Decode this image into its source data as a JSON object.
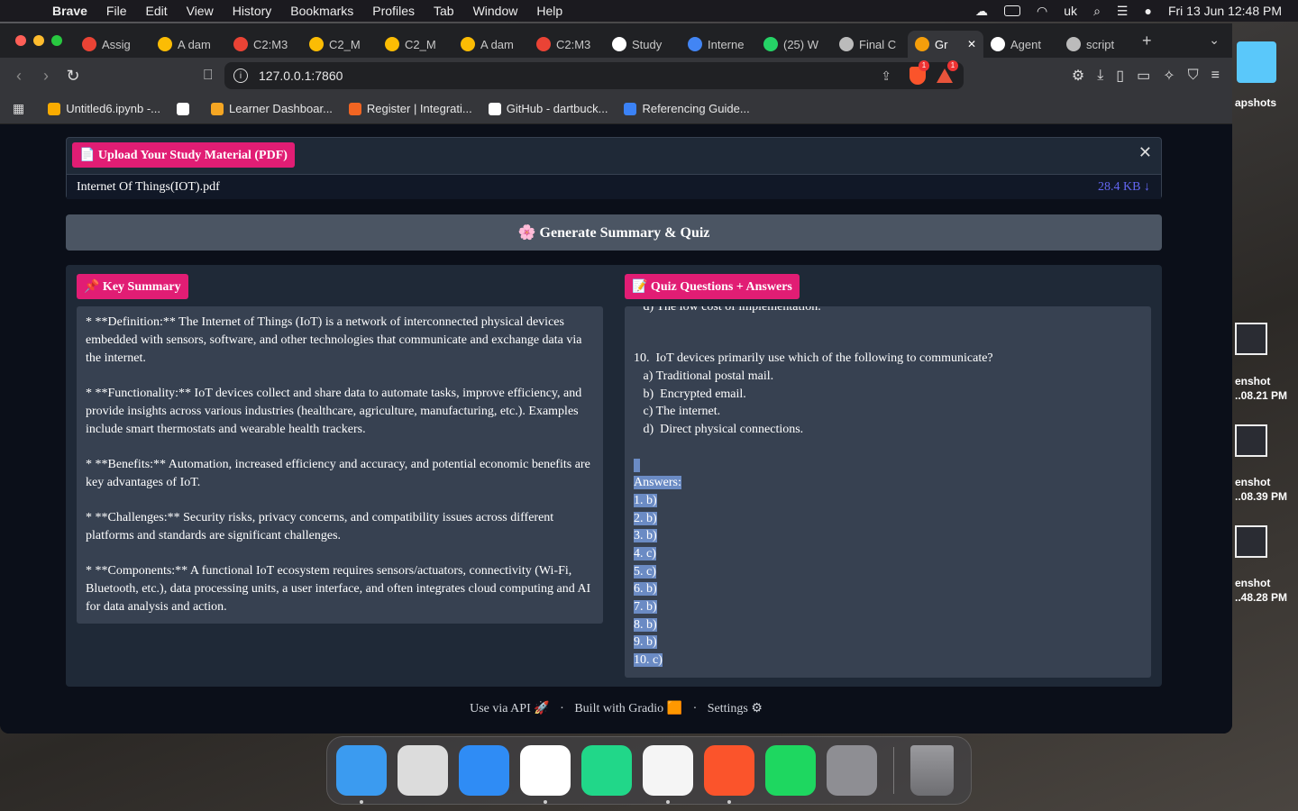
{
  "menubar": {
    "app": "Brave",
    "items": [
      "File",
      "Edit",
      "View",
      "History",
      "Bookmarks",
      "Profiles",
      "Tab",
      "Window",
      "Help"
    ],
    "input_source": "uk",
    "datetime": "Fri 13 Jun  12:48 PM"
  },
  "tabs": [
    {
      "label": "Assig",
      "color": "#ea4335"
    },
    {
      "label": "A dam",
      "color": "#fbbc04"
    },
    {
      "label": "C2:M3",
      "color": "#ea4335"
    },
    {
      "label": "C2_M",
      "color": "#fbbc04"
    },
    {
      "label": "C2_M",
      "color": "#fbbc04"
    },
    {
      "label": "A dam",
      "color": "#fbbc04"
    },
    {
      "label": "C2:M3",
      "color": "#ea4335"
    },
    {
      "label": "Study",
      "color": "#ffffff"
    },
    {
      "label": "Interne",
      "color": "#4285f4"
    },
    {
      "label": "(25) W",
      "color": "#25d366"
    },
    {
      "label": "Final C",
      "color": "#bbbbbb"
    },
    {
      "label": "Gr",
      "color": "#f59e0b",
      "active": true
    },
    {
      "label": "Agent",
      "color": "#ffffff"
    },
    {
      "label": "script",
      "color": "#bbbbbb"
    }
  ],
  "address_bar": {
    "url": "127.0.0.1:7860",
    "shields_badge": "1",
    "rewards_badge": "1"
  },
  "bookmarks": [
    {
      "label": "Untitled6.ipynb -...",
      "color": "#f9ab00"
    },
    {
      "label": "",
      "color": "#ffffff"
    },
    {
      "label": "Learner Dashboar...",
      "color": "#f5a623"
    },
    {
      "label": "Register | Integrati...",
      "color": "#f26522"
    },
    {
      "label": "GitHub - dartbuck...",
      "color": "#ffffff"
    },
    {
      "label": "Referencing Guide...",
      "color": "#3b82f6"
    }
  ],
  "upload": {
    "label": "📄 Upload Your Study Material (PDF)",
    "filename": "Internet Of Things(IOT).pdf",
    "filesize": "28.4 KB ↓"
  },
  "generate_button": "🌸 Generate Summary & Quiz",
  "summary": {
    "label": "📌 Key Summary",
    "paragraphs": [
      "* **Definition:** The Internet of Things (IoT) is a network of interconnected physical devices embedded with sensors, software, and other technologies that communicate and exchange data via the internet.",
      "* **Functionality:** IoT devices collect and share data to automate tasks, improve efficiency, and provide insights across various industries (healthcare, agriculture, manufacturing, etc.).  Examples include smart thermostats and wearable health trackers.",
      "* **Benefits:**  Automation, increased efficiency and accuracy, and potential economic benefits are key advantages of IoT.",
      "* **Challenges:** Security risks, privacy concerns, and compatibility issues across different platforms and standards are significant challenges.",
      "* **Components:**  A functional IoT ecosystem requires sensors/actuators, connectivity (Wi-Fi, Bluetooth, etc.), data processing units, a user interface, and often integrates cloud computing and AI for data analysis and action."
    ]
  },
  "quiz": {
    "label": "📝 Quiz Questions + Answers",
    "cutoff_line": "   d) The low cost of implementation.",
    "question": "10.  IoT devices primarily use which of the following to communicate?",
    "options": [
      "   a) Traditional postal mail.",
      "   b)  Encrypted email.",
      "   c) The internet.",
      "   d)  Direct physical connections."
    ],
    "answers_header": "Answers:",
    "answers": [
      "1. b)",
      "2. b)",
      "3. b)",
      "4. c)",
      "5. c)",
      "6. b)",
      "7. b)",
      "8. b)",
      "9. b)",
      "10. c)"
    ]
  },
  "footer": {
    "api": "Use via API 🚀",
    "built": "Built with Gradio 🟧",
    "settings": "Settings ⚙"
  },
  "desktop": {
    "folder_label": "apshots",
    "screenshots": [
      {
        "line1": "enshot",
        "line2": "..08.21 PM"
      },
      {
        "line1": "enshot",
        "line2": "..08.39 PM"
      },
      {
        "line1": "enshot",
        "line2": "..48.28 PM"
      }
    ]
  },
  "dock": [
    {
      "name": "Finder",
      "color": "#3b9bf0",
      "running": true
    },
    {
      "name": "Launchpad",
      "color": "#dcdcdc",
      "running": false
    },
    {
      "name": "Mail",
      "color": "#2f8cf5",
      "running": false
    },
    {
      "name": "VS Code",
      "color": "#ffffff",
      "running": true
    },
    {
      "name": "PyCharm",
      "color": "#21d789",
      "running": false
    },
    {
      "name": "Safari",
      "color": "#f5f5f5",
      "running": true
    },
    {
      "name": "Brave",
      "color": "#fb542b",
      "running": true
    },
    {
      "name": "Spotify",
      "color": "#1ed760",
      "running": false
    },
    {
      "name": "System Settings",
      "color": "#8e8e93",
      "running": false
    }
  ]
}
